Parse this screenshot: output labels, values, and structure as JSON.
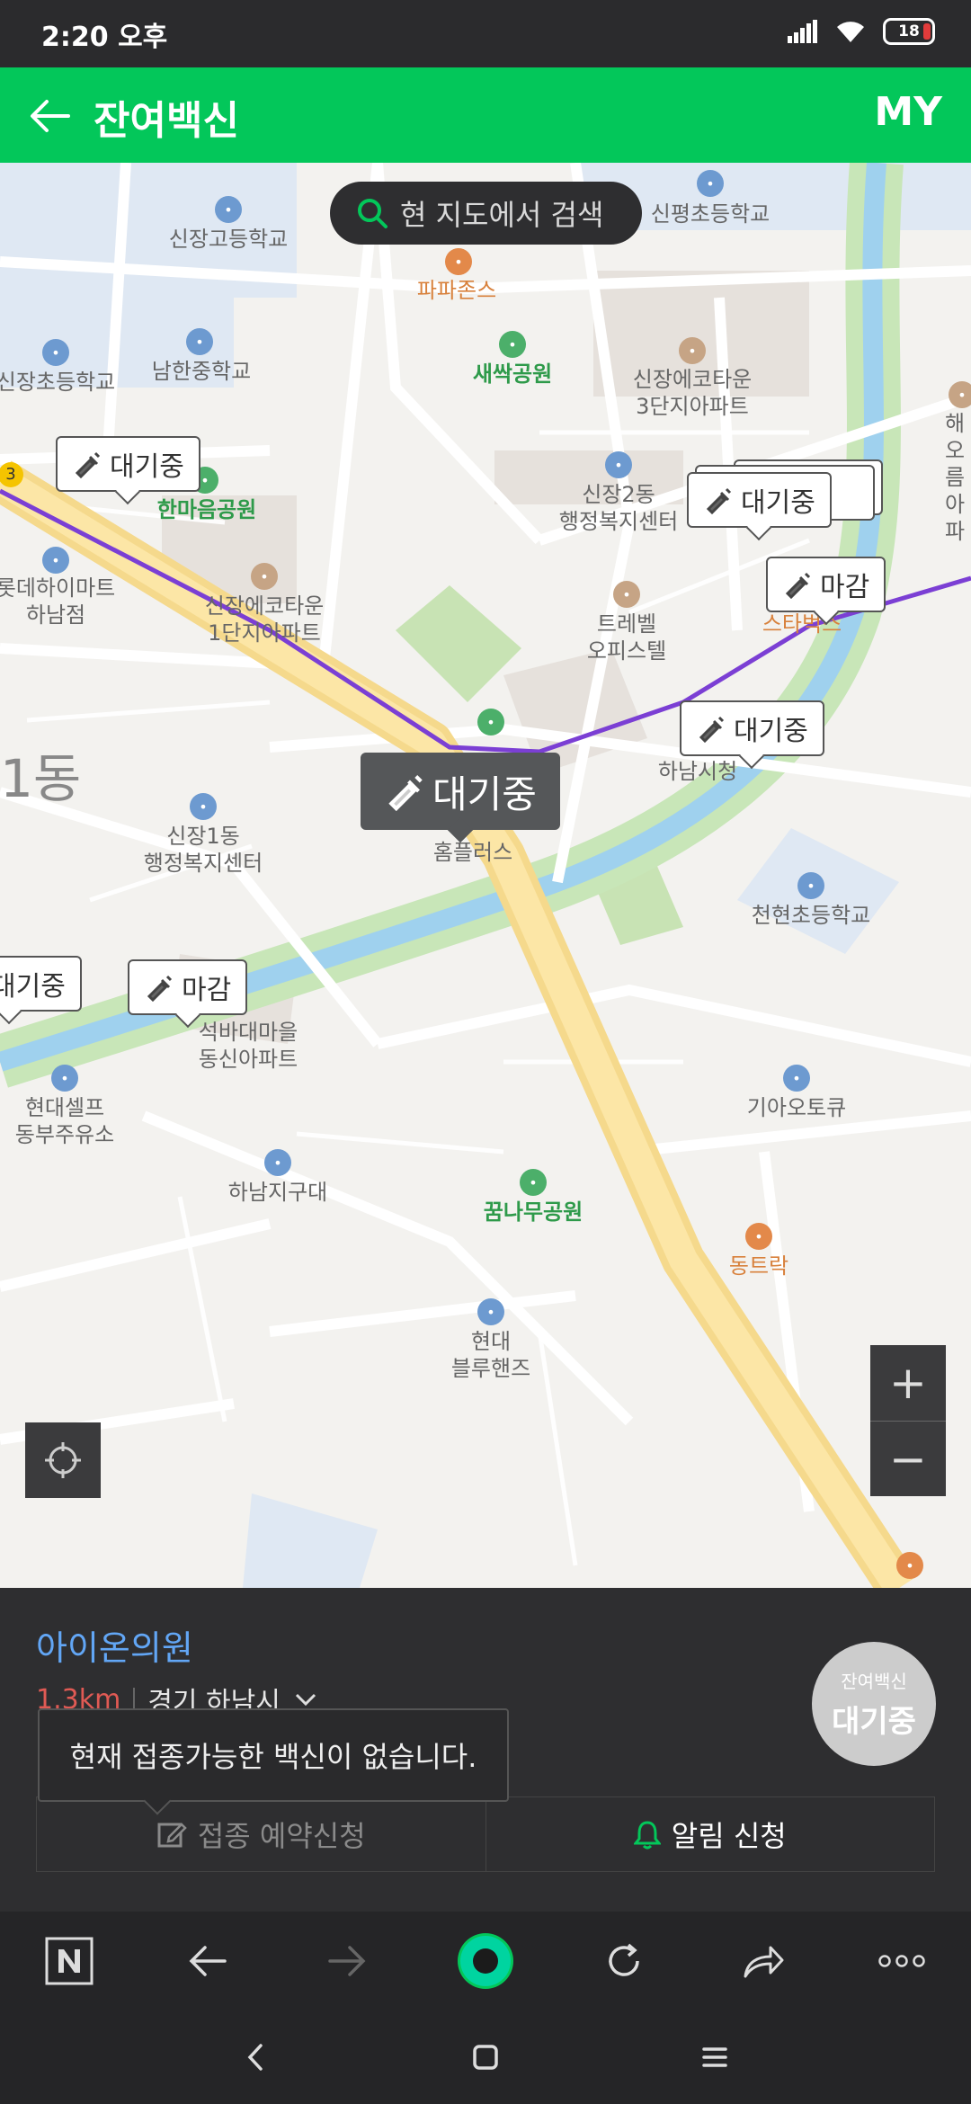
{
  "status_bar": {
    "time": "2:20 오후",
    "battery": "18"
  },
  "app_bar": {
    "title": "잔여백신",
    "my_label": "MY"
  },
  "map": {
    "search_label": "현 지도에서 검색",
    "places": [
      {
        "text": "신장고등학교",
        "style": "normal"
      },
      {
        "text": "신평초등학교",
        "style": "normal"
      },
      {
        "text": "파파존스",
        "style": "orange"
      },
      {
        "text": "새싹공원",
        "style": "green"
      },
      {
        "text": "남한중학교",
        "style": "normal"
      },
      {
        "text": "신장초등학교",
        "style": "normal"
      },
      {
        "text": "신장에코타운\n3단지아파트",
        "style": "normal"
      },
      {
        "text": "해오름\n아파",
        "style": "normal"
      },
      {
        "text": "한마음공원",
        "style": "green"
      },
      {
        "text": "신장2동\n행정복지센터",
        "style": "normal"
      },
      {
        "text": "롯데하이마트\n하남점",
        "style": "normal"
      },
      {
        "text": "신장에코타운\n1단지아파트",
        "style": "normal"
      },
      {
        "text": "트레벨\n오피스텔",
        "style": "normal"
      },
      {
        "text": "스타벅스",
        "style": "orange"
      },
      {
        "text": "하남시청",
        "style": "normal"
      },
      {
        "text": "1동",
        "style": "big"
      },
      {
        "text": "신장1동\n행정복지센터",
        "style": "normal"
      },
      {
        "text": "홈플러스",
        "style": "normal"
      },
      {
        "text": "천현초등학교",
        "style": "normal"
      },
      {
        "text": "석바대마을\n동신아파트",
        "style": "normal"
      },
      {
        "text": "현대셀프\n동부주유소",
        "style": "normal"
      },
      {
        "text": "기아오토큐",
        "style": "normal"
      },
      {
        "text": "하남지구대",
        "style": "normal"
      },
      {
        "text": "꿈나무공원",
        "style": "green"
      },
      {
        "text": "동트락",
        "style": "orange"
      },
      {
        "text": "현대\n블루핸즈",
        "style": "normal"
      },
      {
        "text": "3",
        "style": "normal"
      }
    ],
    "markers": [
      {
        "label": "대기중",
        "variant": "normal"
      },
      {
        "label": "대기중",
        "variant": "stack"
      },
      {
        "label": "마감",
        "variant": "normal"
      },
      {
        "label": "대기중",
        "variant": "normal"
      },
      {
        "label": "대기중",
        "variant": "selected"
      },
      {
        "label": "대기중",
        "variant": "normal"
      },
      {
        "label": "마감",
        "variant": "normal"
      }
    ],
    "zoom_in": "+",
    "zoom_out": "−"
  },
  "sheet": {
    "hospital_name": "아이온의원",
    "distance": "1.3km",
    "region": "경기 하남시",
    "status_top": "잔여백신",
    "status_main": "대기중",
    "tooltip": "현재 접종가능한 백신이 없습니다.",
    "reserve_label": "접종 예약신청",
    "notify_label": "알림 신청"
  },
  "colors": {
    "brand_green": "#03c75a",
    "link_blue": "#62a6f5",
    "route_purple": "#7b3fd4"
  }
}
